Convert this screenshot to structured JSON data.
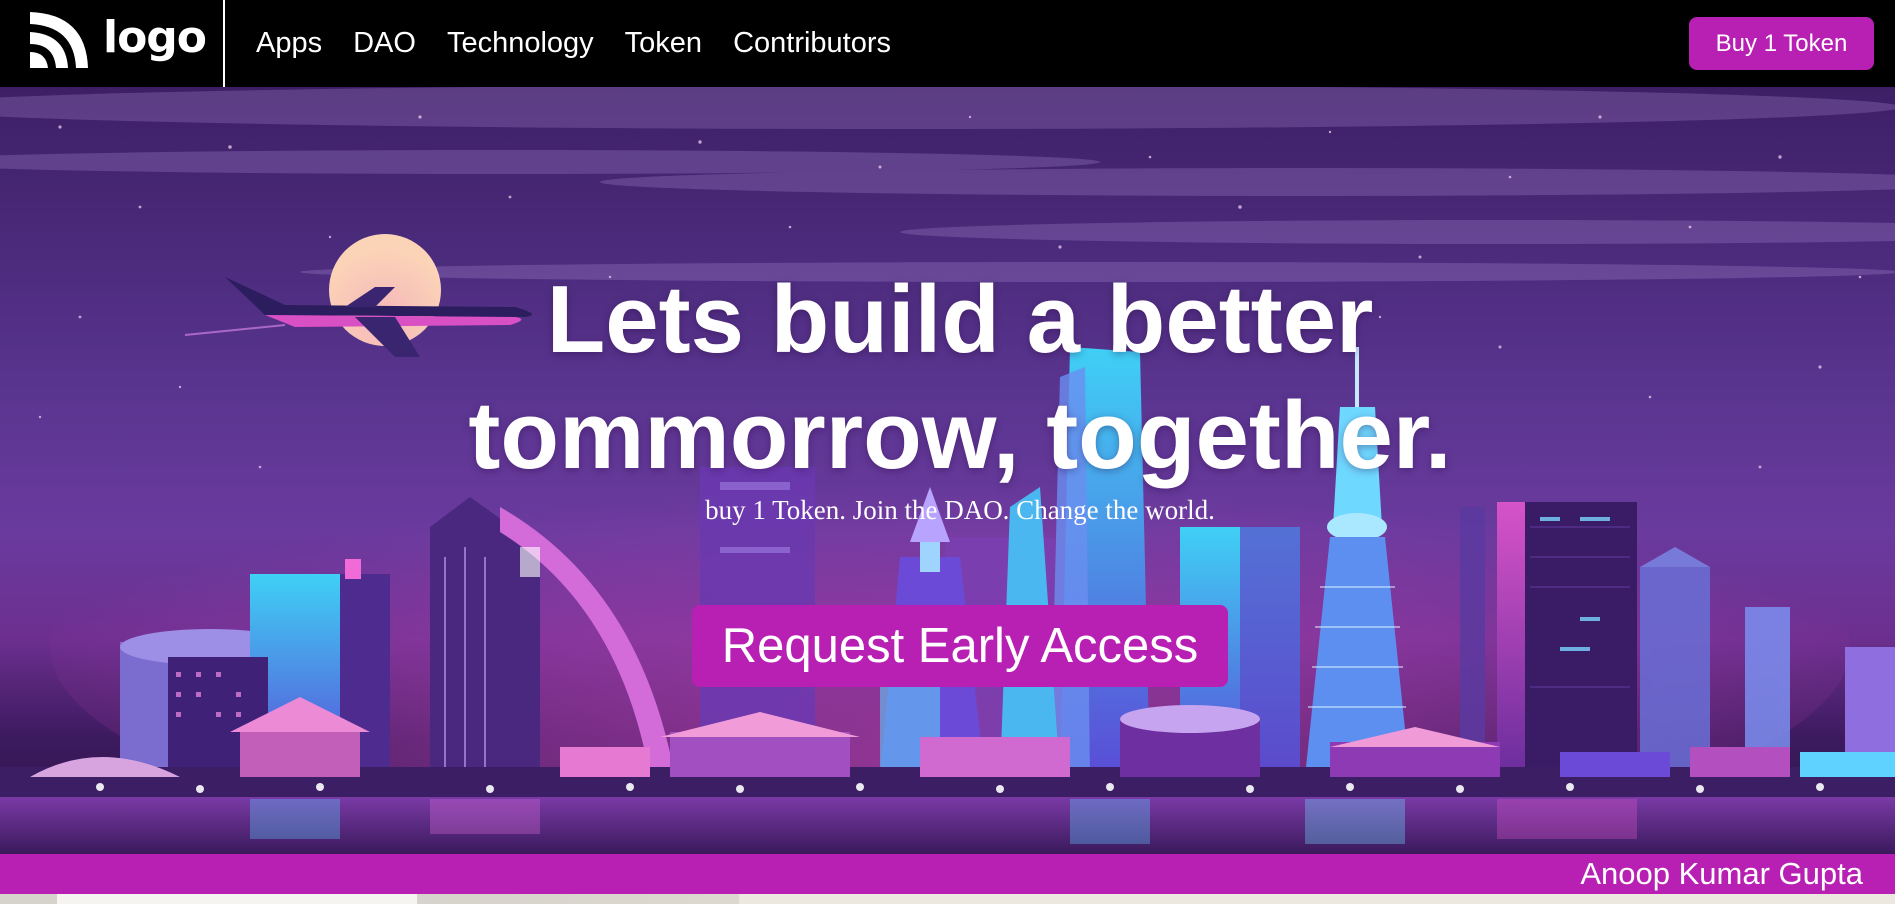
{
  "brand": {
    "logo_text": "logo",
    "logo_icon": "rss-feed-icon"
  },
  "nav": {
    "links": [
      "Apps",
      "DAO",
      "Technology",
      "Token",
      "Contributors"
    ],
    "buy_button": "Buy 1 Token"
  },
  "hero": {
    "headline_line1": "Lets build a better",
    "headline_line2": "tommorrow, together.",
    "tagline": "buy 1 Token. Join the DAO. Change the world.",
    "cta_button": "Request Early Access",
    "background": "neon city skyline at night with airplane and moon"
  },
  "footer": {
    "author": "Anoop Kumar Gupta"
  },
  "colors": {
    "accent": "#b81fb3",
    "nav_background": "#000000",
    "hero_purple": "#5a3590",
    "text": "#ffffff"
  }
}
